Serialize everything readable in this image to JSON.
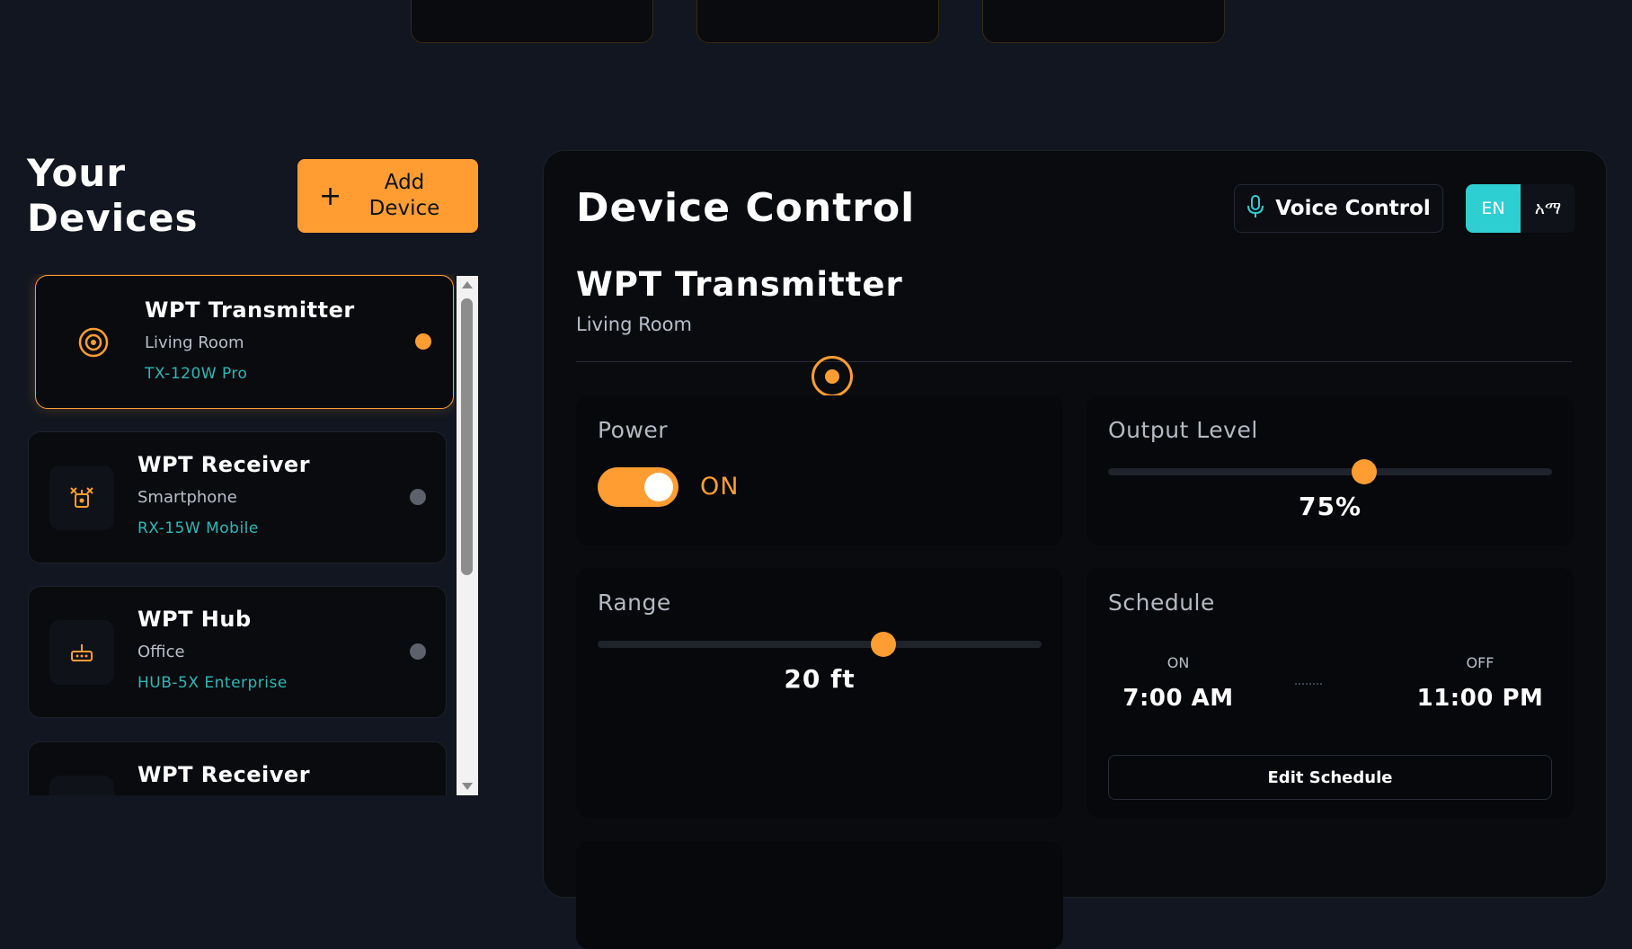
{
  "sidebar": {
    "title": "Your Devices",
    "add_button": {
      "icon": "plus-icon",
      "label": "Add Device"
    },
    "devices": [
      {
        "name": "WPT Transmitter",
        "location": "Living Room",
        "model": "TX-120W Pro",
        "icon": "target-icon",
        "status": "active",
        "status_color": "#ff9d33"
      },
      {
        "name": "WPT Receiver",
        "location": "Smartphone",
        "model": "RX-15W Mobile",
        "icon": "receiver-antenna-icon",
        "status": "inactive",
        "status_color": "#5c616b"
      },
      {
        "name": "WPT Hub",
        "location": "Office",
        "model": "HUB-5X Enterprise",
        "icon": "router-hub-icon",
        "status": "inactive",
        "status_color": "#5c616b"
      },
      {
        "name": "WPT Receiver",
        "location": "",
        "model": "",
        "icon": "receiver-antenna-icon",
        "status": "inactive",
        "status_color": "#5c616b"
      }
    ]
  },
  "control": {
    "title": "Device Control",
    "voice_button": {
      "icon": "microphone-icon",
      "label": "Voice Control"
    },
    "languages": [
      {
        "label": "EN",
        "selected": true
      },
      {
        "label": "አማ",
        "selected": false
      }
    ],
    "device_name": "WPT Transmitter",
    "device_location": "Living Room",
    "power": {
      "title": "Power",
      "state_label": "ON",
      "on": true
    },
    "output": {
      "title": "Output Level",
      "value": "75%",
      "level": 0.62
    },
    "range": {
      "title": "Range",
      "value": "20 ft",
      "level": 0.65
    },
    "schedule": {
      "title": "Schedule",
      "on_label": "ON",
      "on_time": "7:00 AM",
      "off_label": "OFF",
      "off_time": "11:00 PM",
      "edit_label": "Edit Schedule"
    }
  },
  "colors": {
    "accent": "#ff9d33",
    "teal": "#2ecfd2",
    "background": "#111620"
  }
}
